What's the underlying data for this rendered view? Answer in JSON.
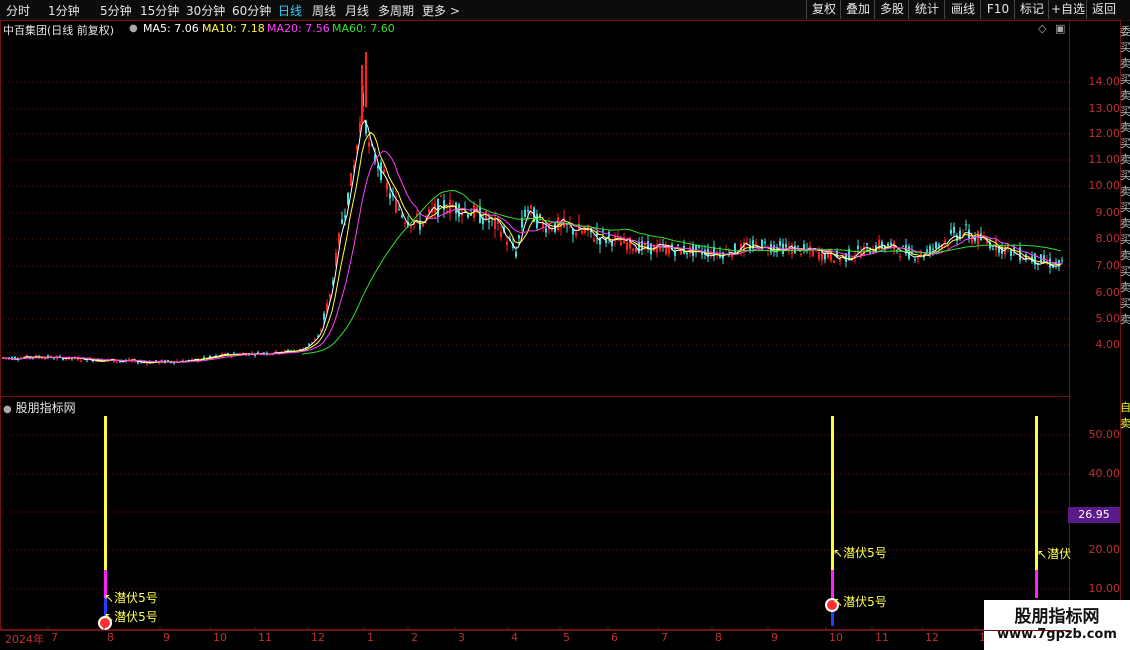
{
  "toolbar": {
    "periods": [
      "分时",
      "1分钟",
      "5分钟",
      "15分钟",
      "30分钟",
      "60分钟",
      "日线",
      "周线",
      "月线",
      "多周期",
      "更多 >"
    ],
    "active_period": "日线",
    "right_buttons": [
      "复权",
      "叠加",
      "多股",
      "统计",
      "画线",
      "F10",
      "标记",
      "+自选",
      "返回"
    ]
  },
  "header": {
    "stock": "中百集团(日线 前复权)",
    "ma5": "MA5: 7.06",
    "ma10": "MA10: 7.18",
    "ma20": "MA20: 7.56",
    "ma60": "MA60: 7.60",
    "ma_colors": {
      "ma5": "#ffffff",
      "ma10": "#ffff40",
      "ma20": "#ff40ff",
      "ma60": "#30e030"
    }
  },
  "main_axis": [
    "14.00",
    "13.00",
    "12.00",
    "11.00",
    "10.00",
    "9.00",
    "8.00",
    "7.00",
    "6.00",
    "5.00",
    "4.00"
  ],
  "indicator": {
    "name": "股朋指标网",
    "axis": [
      "50.00",
      "40.00",
      "30.00",
      "20.00",
      "10.00"
    ],
    "current_value": "26.95",
    "signal_label": "潜伏5号",
    "signal_label_cut": "潜伏"
  },
  "x_axis": [
    "2024年",
    "7",
    "8",
    "9",
    "10",
    "11",
    "12",
    "1",
    "2",
    "3",
    "4",
    "5",
    "6",
    "7",
    "8",
    "9",
    "10",
    "11",
    "12",
    "1"
  ],
  "right_strip_top": "委买卖买卖买卖买卖买卖买卖买卖买卖买卖",
  "right_strip_bottom": "自卖",
  "watermark": {
    "title": "股朋指标网",
    "url": "www.7gpzb.com"
  },
  "colors": {
    "up": "#ff2020",
    "down": "#40e0e0",
    "grid": "#6e1414",
    "bar_yellow": "#ffff40",
    "bar_magenta": "#ff20ff",
    "bar_blue": "#2040ff"
  }
}
